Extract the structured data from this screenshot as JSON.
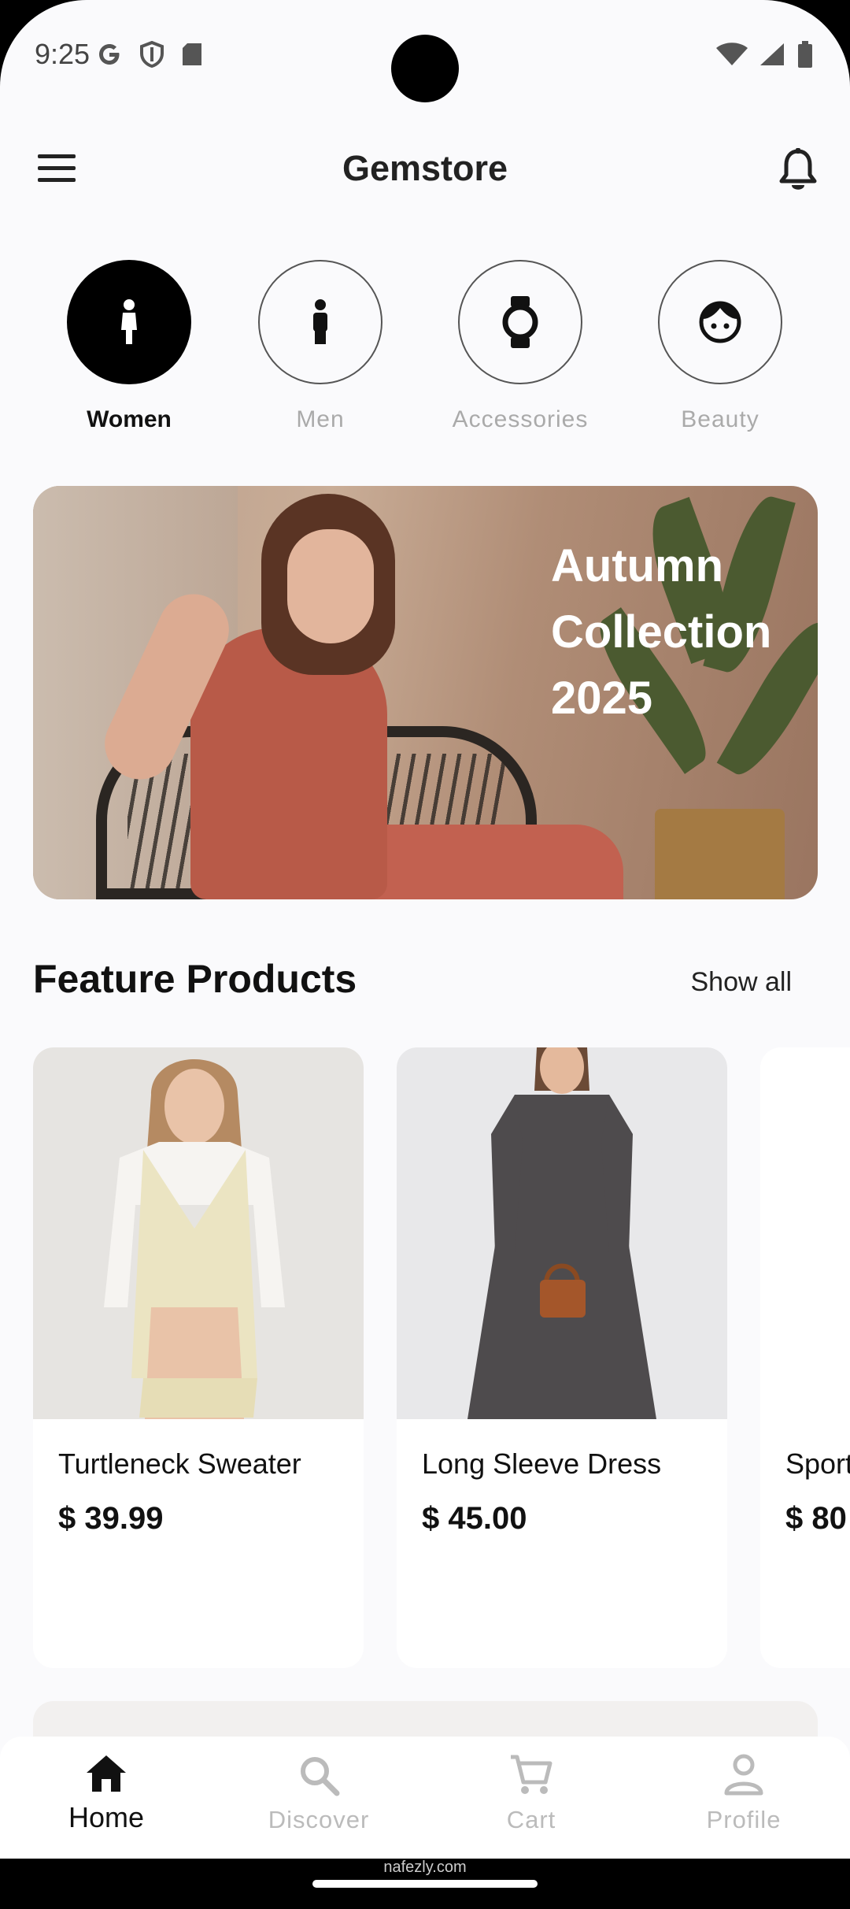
{
  "status_bar": {
    "time": "9:25"
  },
  "header": {
    "title": "Gemstore"
  },
  "categories": [
    {
      "label": "Women",
      "active": true
    },
    {
      "label": "Men",
      "active": false
    },
    {
      "label": "Accessories",
      "active": false
    },
    {
      "label": "Beauty",
      "active": false
    }
  ],
  "banner": {
    "line1": "Autumn",
    "line2": "Collection",
    "line3": "2025"
  },
  "featured": {
    "title": "Feature Products",
    "show_all": "Show all",
    "products": [
      {
        "name": "Turtleneck Sweater",
        "price": "$ 39.99"
      },
      {
        "name": "Long Sleeve Dress",
        "price": "$ 45.00"
      },
      {
        "name": "Sport",
        "price": "$ 80"
      }
    ]
  },
  "bottom_nav": [
    {
      "label": "Home",
      "icon": "home-icon",
      "active": true
    },
    {
      "label": "Discover",
      "icon": "search-icon",
      "active": false
    },
    {
      "label": "Cart",
      "icon": "cart-icon",
      "active": false
    },
    {
      "label": "Profile",
      "icon": "profile-icon",
      "active": false
    }
  ],
  "watermark": "nafezly.com"
}
